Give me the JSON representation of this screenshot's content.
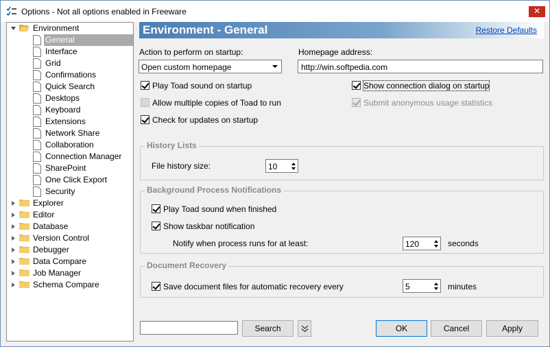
{
  "window": {
    "title": "Options - Not all options enabled in Freeware",
    "close_glyph": "✕"
  },
  "tree": {
    "root": {
      "label": "Environment",
      "expanded": true
    },
    "children": [
      "General",
      "Interface",
      "Grid",
      "Confirmations",
      "Quick Search",
      "Desktops",
      "Keyboard",
      "Extensions",
      "Network Share",
      "Collaboration",
      "Connection Manager",
      "SharePoint",
      "One Click Export",
      "Security"
    ],
    "selected": "General",
    "collapsed_roots": [
      "Explorer",
      "Editor",
      "Database",
      "Version Control",
      "Debugger",
      "Data Compare",
      "Job Manager",
      "Schema Compare"
    ]
  },
  "header": {
    "title": "Environment - General",
    "restore_label": "Restore Defaults"
  },
  "startup": {
    "action_label": "Action to perform on startup:",
    "action_value": "Open custom homepage",
    "homepage_label": "Homepage address:",
    "homepage_value": "http://win.softpedia.com"
  },
  "checks": {
    "play_sound": {
      "label": "Play Toad sound on startup",
      "checked": true
    },
    "multi_copies": {
      "label": "Allow multiple copies of Toad to run",
      "checked": false
    },
    "check_updates": {
      "label": "Check for updates on startup",
      "checked": true
    },
    "show_connection": {
      "label": "Show connection dialog on startup",
      "checked": true
    },
    "anon_stats": {
      "label": "Submit anonymous usage statistics",
      "checked": true,
      "disabled": true
    }
  },
  "history": {
    "title": "History Lists",
    "file_history_label": "File history size:",
    "file_history_value": "10"
  },
  "background": {
    "title": "Background Process Notifications",
    "play_finished": {
      "label": "Play Toad sound when finished",
      "checked": true
    },
    "taskbar": {
      "label": "Show taskbar notification",
      "checked": true
    },
    "notify_label": "Notify when process runs for at least:",
    "notify_value": "120",
    "notify_unit": "seconds"
  },
  "recovery": {
    "title": "Document Recovery",
    "save_label": "Save document files for automatic recovery every",
    "save_checked": true,
    "save_value": "5",
    "save_unit": "minutes"
  },
  "footer": {
    "search_value": "",
    "search_button": "Search",
    "ok": "OK",
    "cancel": "Cancel",
    "apply": "Apply"
  },
  "colors": {
    "header_gradient_start": "#4a7fb5",
    "link": "#0645ad",
    "close": "#c42b1c",
    "selection": "#aaaaaa"
  }
}
